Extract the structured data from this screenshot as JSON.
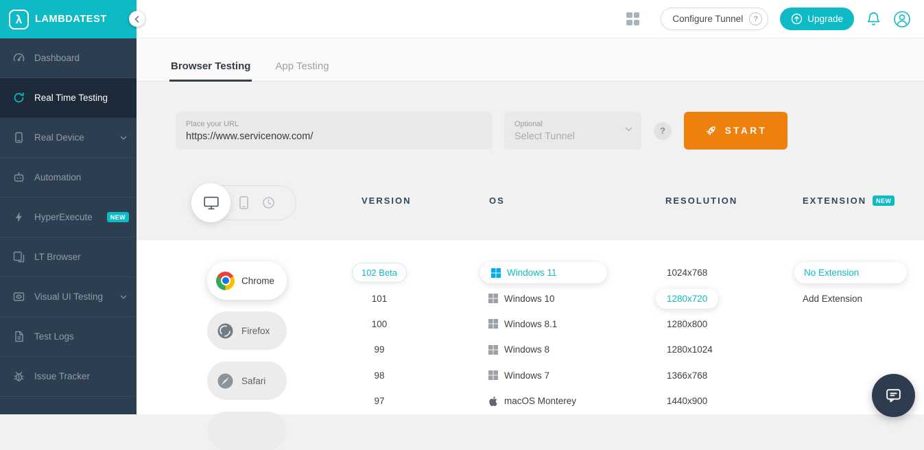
{
  "colors": {
    "accent_teal": "#0ebac5",
    "start_orange": "#ee810e",
    "sidebar_bg": "#2d3e50",
    "windows_blue": "#00adef",
    "selected_text": "#0ebac5"
  },
  "sidebar": {
    "logo_text": "LAMBDATEST",
    "items": [
      {
        "label": "Dashboard"
      },
      {
        "label": "Real Time Testing",
        "active": true
      },
      {
        "label": "Real Device",
        "expandable": true
      },
      {
        "label": "Automation"
      },
      {
        "label": "HyperExecute",
        "badge": "NEW"
      },
      {
        "label": "LT Browser"
      },
      {
        "label": "Visual UI Testing",
        "expandable": true
      },
      {
        "label": "Test Logs"
      },
      {
        "label": "Issue Tracker"
      }
    ]
  },
  "topbar": {
    "configure_tunnel_label": "Configure Tunnel",
    "help_glyph": "?",
    "upgrade_label": "Upgrade"
  },
  "tabs": [
    {
      "label": "Browser Testing",
      "active": true
    },
    {
      "label": "App Testing",
      "active": false
    }
  ],
  "url_section": {
    "url_label": "Place your URL",
    "url_value": "https://www.servicenow.com/",
    "tunnel_label": "Optional",
    "tunnel_placeholder": "Select Tunnel",
    "help_glyph": "?",
    "start_label": "START"
  },
  "column_headers": {
    "version": "VERSION",
    "os": "OS",
    "resolution": "RESOLUTION",
    "extension": "EXTENSION",
    "extension_badge": "NEW"
  },
  "browsers": [
    {
      "name": "Chrome",
      "selected": true
    },
    {
      "name": "Firefox",
      "selected": false
    },
    {
      "name": "Safari",
      "selected": false
    }
  ],
  "versions": [
    {
      "label": "102 Beta",
      "selected": true
    },
    {
      "label": "101",
      "selected": false
    },
    {
      "label": "100",
      "selected": false
    },
    {
      "label": "99",
      "selected": false
    },
    {
      "label": "98",
      "selected": false
    },
    {
      "label": "97",
      "selected": false
    }
  ],
  "operating_systems": [
    {
      "label": "Windows 11",
      "icon": "windows",
      "selected": true
    },
    {
      "label": "Windows 10",
      "icon": "windows",
      "selected": false
    },
    {
      "label": "Windows 8.1",
      "icon": "windows",
      "selected": false
    },
    {
      "label": "Windows 8",
      "icon": "windows",
      "selected": false
    },
    {
      "label": "Windows 7",
      "icon": "windows",
      "selected": false
    },
    {
      "label": "macOS Monterey",
      "icon": "apple",
      "selected": false
    }
  ],
  "resolutions": [
    {
      "label": "1024x768",
      "selected": false
    },
    {
      "label": "1280x720",
      "selected": true
    },
    {
      "label": "1280x800",
      "selected": false
    },
    {
      "label": "1280x1024",
      "selected": false
    },
    {
      "label": "1366x768",
      "selected": false
    },
    {
      "label": "1440x900",
      "selected": false
    }
  ],
  "extensions": [
    {
      "label": "No Extension",
      "selected": true
    },
    {
      "label": "Add Extension",
      "selected": false
    }
  ]
}
